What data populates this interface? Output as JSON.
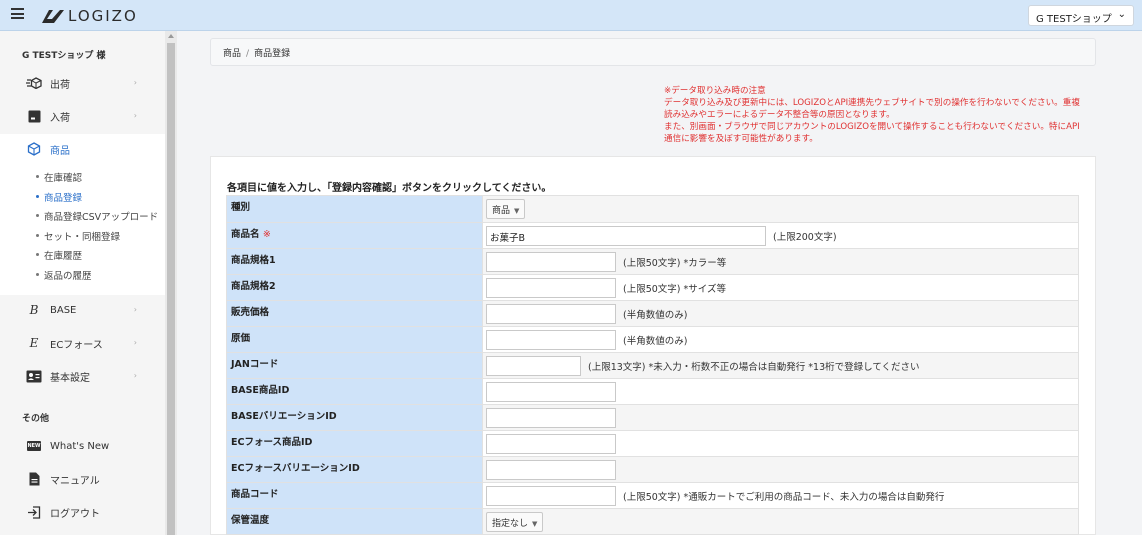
{
  "header": {
    "brand": "LOGIZO",
    "shop_selector": "G TESTショップ"
  },
  "sidebar": {
    "shop_name": "G TESTショップ 様",
    "items": [
      {
        "label": "出荷"
      },
      {
        "label": "入荷"
      },
      {
        "label": "商品"
      },
      {
        "label": "BASE"
      },
      {
        "label": "ECフォース"
      },
      {
        "label": "基本設定"
      }
    ],
    "sub_items": [
      {
        "label": "在庫確認"
      },
      {
        "label": "商品登録"
      },
      {
        "label": "商品登録CSVアップロード"
      },
      {
        "label": "セット・同梱登録"
      },
      {
        "label": "在庫履歴"
      },
      {
        "label": "返品の履歴"
      }
    ],
    "other_section": "その他",
    "other_items": [
      {
        "label": "What's New"
      },
      {
        "label": "マニュアル"
      },
      {
        "label": "ログアウト"
      }
    ],
    "letters": {
      "base": "B",
      "ecforce": "E"
    },
    "new_badge": "NEW"
  },
  "breadcrumb": {
    "root": "商品",
    "separator": "/",
    "current": "商品登録"
  },
  "notice": {
    "lines": [
      "※データ取り込み時の注意",
      "データ取り込み及び更新中には、LOGIZOとAPI連携先ウェブサイトで別の操作を行わないでください。重複読み込みやエラーによるデータ不整合等の原因となります。",
      "また、別画面・ブラウザで同じアカウントのLOGIZOを開いて操作することも行わないでください。特にAPI通信に影響を及ぼす可能性があります。"
    ]
  },
  "form": {
    "instruction": "各項目に値を入力し、「登録内容確認」ボタンをクリックしてください。",
    "required_mark": "※",
    "rows": [
      {
        "label": "種別",
        "select": "商品"
      },
      {
        "label": "商品名",
        "value": "お菓子B",
        "hint": "(上限200文字)"
      },
      {
        "label": "商品規格1",
        "value": "",
        "hint": "(上限50文字) *カラー等"
      },
      {
        "label": "商品規格2",
        "value": "",
        "hint": "(上限50文字) *サイズ等"
      },
      {
        "label": "販売価格",
        "value": "",
        "hint": "(半角数値のみ)"
      },
      {
        "label": "原価",
        "value": "",
        "hint": "(半角数値のみ)"
      },
      {
        "label": "JANコード",
        "value": "",
        "hint": "(上限13文字) *未入力・桁数不正の場合は自動発行 *13桁で登録してください"
      },
      {
        "label": "BASE商品ID",
        "value": ""
      },
      {
        "label": "BASEバリエーションID",
        "value": ""
      },
      {
        "label": "ECフォース商品ID",
        "value": ""
      },
      {
        "label": "ECフォースバリエーションID",
        "value": ""
      },
      {
        "label": "商品コード",
        "value": "",
        "hint": "(上限50文字) *通販カートでご利用の商品コード、未入力の場合は自動発行"
      },
      {
        "label": "保管温度",
        "select": "指定なし"
      }
    ]
  }
}
